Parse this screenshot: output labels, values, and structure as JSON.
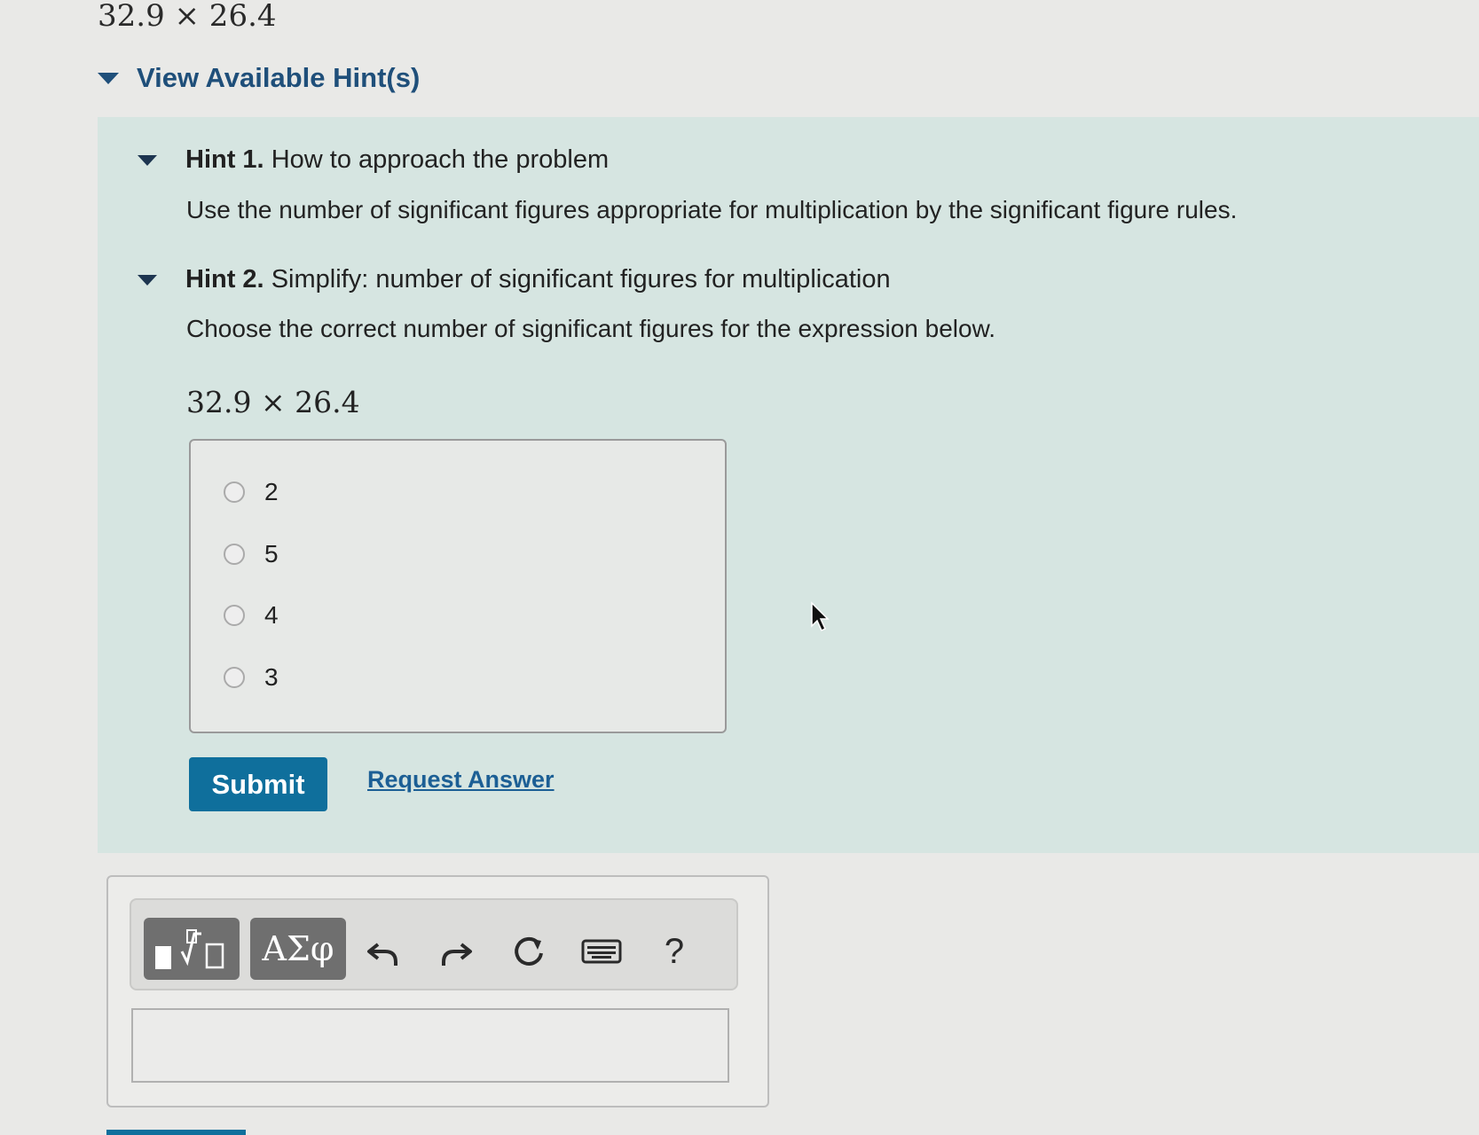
{
  "problem": {
    "expression": "32.9 × 26.4"
  },
  "hints_toggle": {
    "label": "View Available Hint(s)"
  },
  "hint1": {
    "title": "Hint 1.",
    "subtitle": "How to approach the problem",
    "text": "Use the number of significant figures appropriate for multiplication by the significant figure rules."
  },
  "hint2": {
    "title": "Hint 2.",
    "subtitle": "Simplify: number of significant figures for multiplication",
    "text": "Choose the correct number of significant figures for the expression below.",
    "expression": "32.9 × 26.4",
    "choices": [
      "2",
      "5",
      "4",
      "3"
    ]
  },
  "actions": {
    "submit": "Submit",
    "request_answer": "Request Answer"
  },
  "toolbar": {
    "greek_label": "ΑΣφ",
    "help_label": "?",
    "icons": [
      "templates-icon",
      "greek-symbols-icon",
      "undo-icon",
      "redo-icon",
      "reset-icon",
      "keyboard-icon",
      "help-icon"
    ]
  },
  "colors": {
    "accent": "#0f6f9c",
    "link": "#1c5f95",
    "hint_bg": "#d6e5e1",
    "page_bg": "#e9e9e7"
  }
}
